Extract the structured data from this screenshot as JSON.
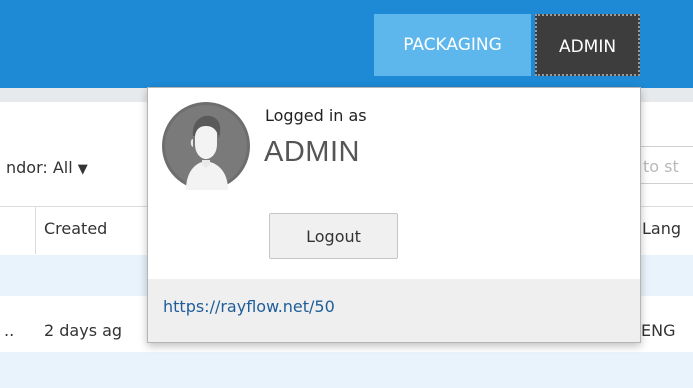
{
  "topbar": {
    "nav_packaging": "PACKAGING",
    "nav_admin": "ADMIN"
  },
  "filters": {
    "vendor_label": "ndor: All",
    "search_placeholder": "to st"
  },
  "table": {
    "headers": {
      "created": "Created",
      "language": "Lang"
    },
    "rows": [
      {
        "leading": "..",
        "created": "2 days ag",
        "language": "ENG"
      }
    ]
  },
  "user_menu": {
    "logged_in_label": "Logged in as",
    "username": "ADMIN",
    "logout_label": "Logout",
    "footer_link": "https://rayflow.net/50"
  },
  "colors": {
    "topbar": "#1e8ad6",
    "packaging_tab": "#5db7ec",
    "admin_tab": "#3d3d3d",
    "row_highlight": "#e9f3fb",
    "link": "#1f5d99"
  },
  "icons": {
    "avatar": "user-avatar-icon",
    "vendor_caret": "caret-down-icon"
  }
}
